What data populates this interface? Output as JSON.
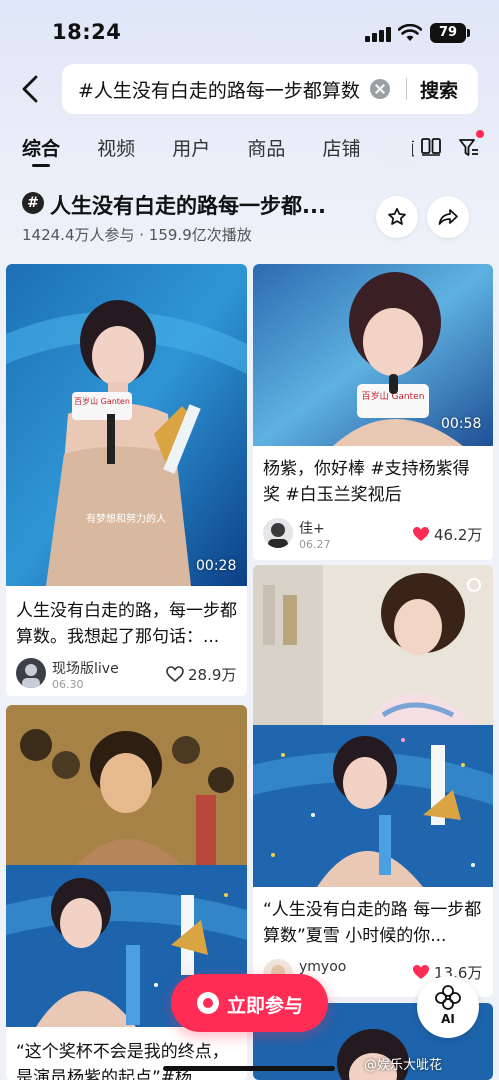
{
  "status_bar": {
    "time": "18:24",
    "battery": "79"
  },
  "search": {
    "query": "#人生没有白走的路每一步都算数",
    "button": "搜索"
  },
  "tabs": [
    "综合",
    "视频",
    "用户",
    "商品",
    "店铺",
    "直播"
  ],
  "topic": {
    "icon": "#",
    "title": "人生没有白走的路每一步都...",
    "stats": "1424.4万人参与 · 159.9亿次播放"
  },
  "cards": [
    {
      "duration": "00:28",
      "title": "人生没有白走的路，每一步都算数。我想起了那句话：...",
      "author": "现场版live",
      "date": "06.30",
      "likes": "28.9万",
      "liked": false,
      "thumb_text": "百岁山 Ganten",
      "subtitle": "有梦想和努力的人"
    },
    {
      "duration": "00:58",
      "title": "杨紫，你好棒 #支持杨紫得奖 #白玉兰奖视后",
      "author": "佳+",
      "date": "06.27",
      "likes": "46.2万",
      "liked": true,
      "thumb_text": "百岁山 Ganten"
    },
    {
      "title": "“人生没有白走的路 每一步都算数”夏雪  小时候的你...",
      "author": "ymyoo",
      "likes": "13.6万",
      "liked": true
    },
    {
      "title": "“这个奖杯不会是我的终点，是演员杨紫的起点”#杨"
    }
  ],
  "bottom": {
    "join_label": "立即参与",
    "ai_label": "AI"
  },
  "watermark": "@娱乐大呲花",
  "colors": {
    "accent": "#ff2c55",
    "text": "#111111",
    "muted": "#999999"
  }
}
